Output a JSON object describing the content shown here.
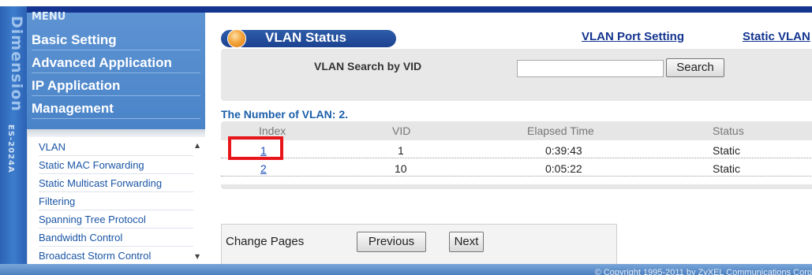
{
  "top": {
    "text": "",
    "accent": "#14358f"
  },
  "brand": {
    "name": "Dimension",
    "model": "ES-2024A"
  },
  "menu": {
    "title": "MENU",
    "items": [
      {
        "label": "Basic Setting"
      },
      {
        "label": "Advanced Application"
      },
      {
        "label": "IP Application"
      },
      {
        "label": "Management"
      }
    ]
  },
  "submenu": {
    "items": [
      {
        "label": "VLAN"
      },
      {
        "label": "Static MAC Forwarding"
      },
      {
        "label": "Static Multicast Forwarding"
      },
      {
        "label": "Filtering"
      },
      {
        "label": "Spanning Tree Protocol"
      },
      {
        "label": "Bandwidth Control"
      },
      {
        "label": "Broadcast Storm Control"
      }
    ]
  },
  "content": {
    "title": "VLAN Status",
    "links": {
      "port_setting": "VLAN Port Setting",
      "static_vlan": "Static VLAN"
    },
    "search": {
      "label": "VLAN Search by VID",
      "value": "",
      "button": "Search"
    },
    "count_text": "The Number of VLAN: 2.",
    "table": {
      "headers": {
        "index": "Index",
        "vid": "VID",
        "elapsed": "Elapsed Time",
        "status": "Status"
      },
      "rows": [
        {
          "index": "1",
          "vid": "1",
          "elapsed": "0:39:43",
          "status": "Static"
        },
        {
          "index": "2",
          "vid": "10",
          "elapsed": "0:05:22",
          "status": "Static"
        }
      ]
    },
    "pages": {
      "label": "Change Pages",
      "previous": "Previous",
      "next": "Next"
    }
  },
  "footer": {
    "copyright": "© Copyright 1995-2011 by ZyXEL Communications Corp"
  }
}
